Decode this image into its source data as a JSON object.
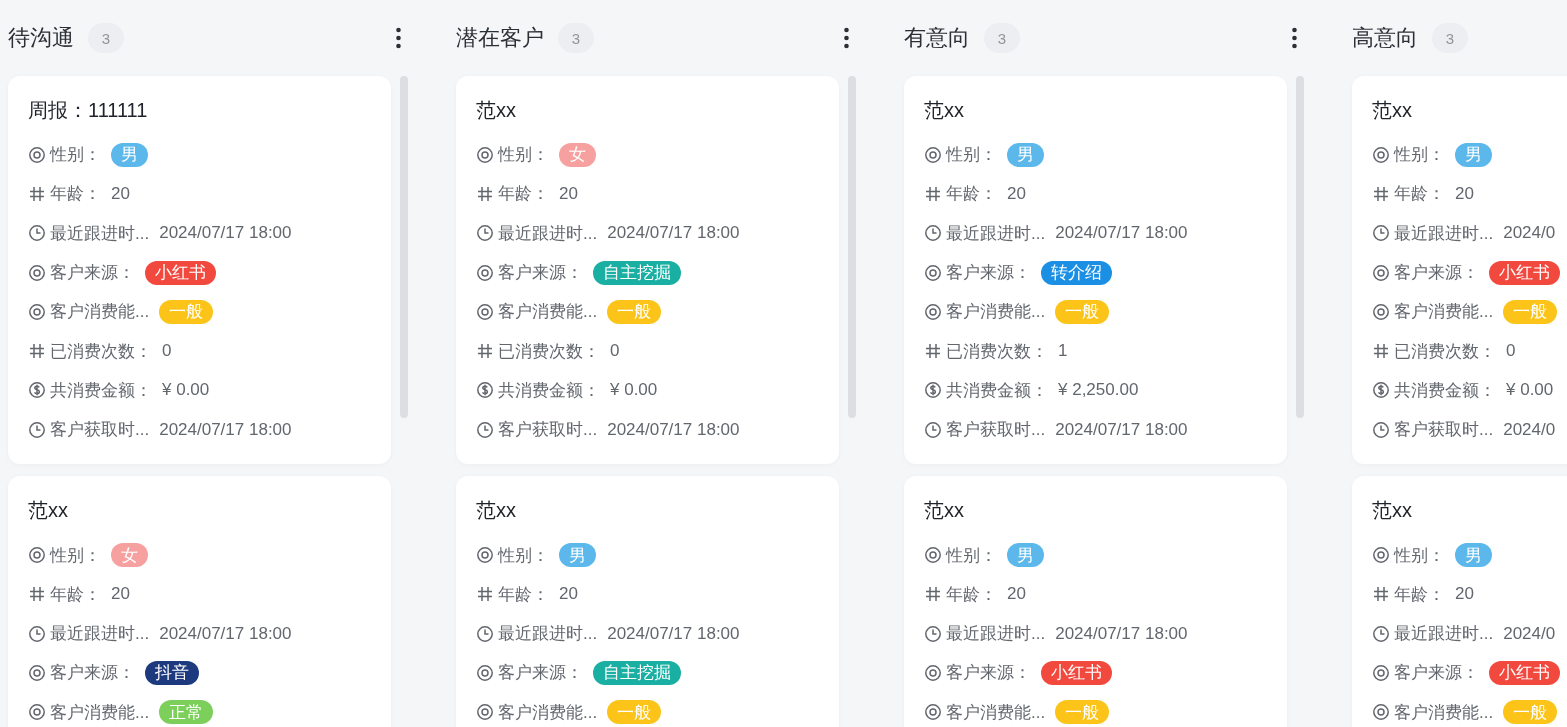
{
  "columns": [
    {
      "title": "待沟通",
      "count": "3",
      "menu": true,
      "scrollbar": true,
      "cards": [
        {
          "title": "周报：111111",
          "fields": [
            {
              "label": "性别：",
              "kind": "tag",
              "value": "男",
              "color": "#5cb8ea"
            },
            {
              "label": "年龄：",
              "kind": "text",
              "value": "20"
            },
            {
              "label": "最近跟进时...",
              "kind": "text",
              "value": "2024/07/17 18:00"
            },
            {
              "label": "客户来源：",
              "kind": "tag",
              "value": "小红书",
              "color": "#f2493f"
            },
            {
              "label": "客户消费能...",
              "kind": "tag",
              "value": "一般",
              "color": "#fcc419"
            },
            {
              "label": "已消费次数：",
              "kind": "text",
              "value": "0"
            },
            {
              "label": "共消费金额：",
              "kind": "text",
              "value": "¥ 0.00"
            },
            {
              "label": "客户获取时...",
              "kind": "text",
              "value": "2024/07/17 18:00"
            }
          ]
        },
        {
          "title": "范xx",
          "fields": [
            {
              "label": "性别：",
              "kind": "tag",
              "value": "女",
              "color": "#f7a0a0"
            },
            {
              "label": "年龄：",
              "kind": "text",
              "value": "20"
            },
            {
              "label": "最近跟进时...",
              "kind": "text",
              "value": "2024/07/17 18:00"
            },
            {
              "label": "客户来源：",
              "kind": "tag",
              "value": "抖音",
              "color": "#1e3a7e"
            },
            {
              "label": "客户消费能...",
              "kind": "tag",
              "value": "正常",
              "color": "#7ccf5a"
            }
          ]
        }
      ]
    },
    {
      "title": "潜在客户",
      "count": "3",
      "menu": true,
      "scrollbar": true,
      "cards": [
        {
          "title": "范xx",
          "fields": [
            {
              "label": "性别：",
              "kind": "tag",
              "value": "女",
              "color": "#f7a0a0"
            },
            {
              "label": "年龄：",
              "kind": "text",
              "value": "20"
            },
            {
              "label": "最近跟进时...",
              "kind": "text",
              "value": "2024/07/17 18:00"
            },
            {
              "label": "客户来源：",
              "kind": "tag",
              "value": "自主挖掘",
              "color": "#1aafa3"
            },
            {
              "label": "客户消费能...",
              "kind": "tag",
              "value": "一般",
              "color": "#fcc419"
            },
            {
              "label": "已消费次数：",
              "kind": "text",
              "value": "0"
            },
            {
              "label": "共消费金额：",
              "kind": "text",
              "value": "¥ 0.00"
            },
            {
              "label": "客户获取时...",
              "kind": "text",
              "value": "2024/07/17 18:00"
            }
          ]
        },
        {
          "title": "范xx",
          "fields": [
            {
              "label": "性别：",
              "kind": "tag",
              "value": "男",
              "color": "#5cb8ea"
            },
            {
              "label": "年龄：",
              "kind": "text",
              "value": "20"
            },
            {
              "label": "最近跟进时...",
              "kind": "text",
              "value": "2024/07/17 18:00"
            },
            {
              "label": "客户来源：",
              "kind": "tag",
              "value": "自主挖掘",
              "color": "#1aafa3"
            },
            {
              "label": "客户消费能...",
              "kind": "tag",
              "value": "一般",
              "color": "#fcc419"
            }
          ]
        }
      ]
    },
    {
      "title": "有意向",
      "count": "3",
      "menu": true,
      "scrollbar": true,
      "cards": [
        {
          "title": "范xx",
          "fields": [
            {
              "label": "性别：",
              "kind": "tag",
              "value": "男",
              "color": "#5cb8ea"
            },
            {
              "label": "年龄：",
              "kind": "text",
              "value": "20"
            },
            {
              "label": "最近跟进时...",
              "kind": "text",
              "value": "2024/07/17 18:00"
            },
            {
              "label": "客户来源：",
              "kind": "tag",
              "value": "转介绍",
              "color": "#1a8fe3"
            },
            {
              "label": "客户消费能...",
              "kind": "tag",
              "value": "一般",
              "color": "#fcc419"
            },
            {
              "label": "已消费次数：",
              "kind": "text",
              "value": "1"
            },
            {
              "label": "共消费金额：",
              "kind": "text",
              "value": "¥ 2,250.00"
            },
            {
              "label": "客户获取时...",
              "kind": "text",
              "value": "2024/07/17 18:00"
            }
          ]
        },
        {
          "title": "范xx",
          "fields": [
            {
              "label": "性别：",
              "kind": "tag",
              "value": "男",
              "color": "#5cb8ea"
            },
            {
              "label": "年龄：",
              "kind": "text",
              "value": "20"
            },
            {
              "label": "最近跟进时...",
              "kind": "text",
              "value": "2024/07/17 18:00"
            },
            {
              "label": "客户来源：",
              "kind": "tag",
              "value": "小红书",
              "color": "#f2493f"
            },
            {
              "label": "客户消费能...",
              "kind": "tag",
              "value": "一般",
              "color": "#fcc419"
            }
          ]
        }
      ]
    },
    {
      "title": "高意向",
      "count": "3",
      "cards": [
        {
          "title": "范xx",
          "fields": [
            {
              "label": "性别：",
              "kind": "tag",
              "value": "男",
              "color": "#5cb8ea"
            },
            {
              "label": "年龄：",
              "kind": "text",
              "value": "20"
            },
            {
              "label": "最近跟进时...",
              "kind": "text",
              "value": "2024/0"
            },
            {
              "label": "客户来源：",
              "kind": "tag",
              "value": "小红书",
              "color": "#f2493f"
            },
            {
              "label": "客户消费能...",
              "kind": "tag",
              "value": "一般",
              "color": "#fcc419"
            },
            {
              "label": "已消费次数：",
              "kind": "text",
              "value": "0"
            },
            {
              "label": "共消费金额：",
              "kind": "text",
              "value": "¥ 0.00"
            },
            {
              "label": "客户获取时...",
              "kind": "text",
              "value": "2024/0"
            }
          ]
        },
        {
          "title": "范xx",
          "fields": [
            {
              "label": "性别：",
              "kind": "tag",
              "value": "男",
              "color": "#5cb8ea"
            },
            {
              "label": "年龄：",
              "kind": "text",
              "value": "20"
            },
            {
              "label": "最近跟进时...",
              "kind": "text",
              "value": "2024/0"
            },
            {
              "label": "客户来源：",
              "kind": "tag",
              "value": "小红书",
              "color": "#f2493f"
            },
            {
              "label": "客户消费能...",
              "kind": "tag",
              "value": "一般",
              "color": "#fcc419"
            }
          ]
        }
      ]
    }
  ]
}
